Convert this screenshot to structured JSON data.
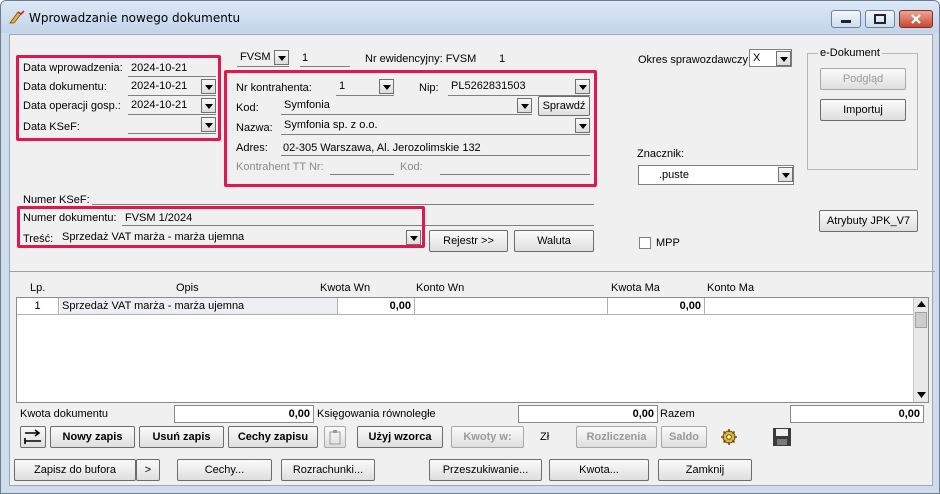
{
  "window": {
    "title": "Wprowadzanie nowego dokumentu"
  },
  "dates": {
    "entry_label": "Data wprowadzenia:",
    "entry_value": "2024-10-21",
    "doc_label": "Data dokumentu:",
    "doc_value": "2024-10-21",
    "op_label": "Data operacji gosp.:",
    "op_value": "2024-10-21",
    "ksef_label": "Data KSeF:",
    "ksef_value": ""
  },
  "header": {
    "series": "FVSM",
    "number": "1",
    "reg_label": "Nr ewidencyjny: FVSM",
    "reg_value": "1",
    "period_label": "Okres sprawozdawczy:",
    "period_value": "X"
  },
  "contractor": {
    "nr_label": "Nr kontrahenta:",
    "nr_value": "1",
    "nip_label": "Nip:",
    "nip_value": "PL5262831503",
    "code_label": "Kod:",
    "code_value": "Symfonia",
    "check_button": "Sprawdź",
    "name_label": "Nazwa:",
    "name_value": "Symfonia sp. z o.o.",
    "address_label": "Adres:",
    "address_value": "02-305 Warszawa, Al. Jerozolimskie 132",
    "tt_label": "Kontrahent TT Nr:",
    "tt_code_label": "Kod:"
  },
  "edoc": {
    "title": "e-Dokument",
    "preview": "Podgląd",
    "import": "Importuj"
  },
  "marker": {
    "label": "Znacznik:",
    "value": ".puste"
  },
  "ksef_number_label": "Numer KSeF:",
  "docnum": {
    "label": "Numer dokumentu:",
    "value": "FVSM 1/2024"
  },
  "content": {
    "label": "Treść:",
    "value": "Sprzedaż VAT marża - marża ujemna"
  },
  "buttons": {
    "register": "Rejestr >>",
    "currency": "Waluta",
    "jpk": "Atrybuty JPK_V7"
  },
  "mpp_label": "MPP",
  "grid": {
    "columns": [
      "Lp.",
      "Opis",
      "Kwota Wn",
      "Konto Wn",
      "Kwota Ma",
      "Konto Ma"
    ],
    "rows": [
      {
        "lp": "1",
        "opis": "Sprzedaż VAT marża - marża ujemna",
        "wn": "0,00",
        "konto_wn": "",
        "ma": "0,00",
        "konto_ma": ""
      }
    ]
  },
  "totals": {
    "doc_label": "Kwota dokumentu",
    "doc_value": "0,00",
    "parallel_label": "Księgowania równoległe",
    "parallel_value": "0,00",
    "sum_label": "Razem",
    "sum_value": "0,00"
  },
  "toolbar": {
    "new": "Nowy zapis",
    "delete": "Usuń zapis",
    "features": "Cechy zapisu",
    "template": "Użyj wzorca",
    "amounts": "Kwoty w:",
    "currency": "Zł",
    "settlements": "Rozliczenia",
    "balance": "Saldo"
  },
  "footer": {
    "draft": "Zapisz do bufora",
    "more": ">",
    "features": "Cechy...",
    "settlements": "Rozrachunki...",
    "search": "Przeszukiwanie...",
    "amount": "Kwota...",
    "close": "Zamknij"
  }
}
